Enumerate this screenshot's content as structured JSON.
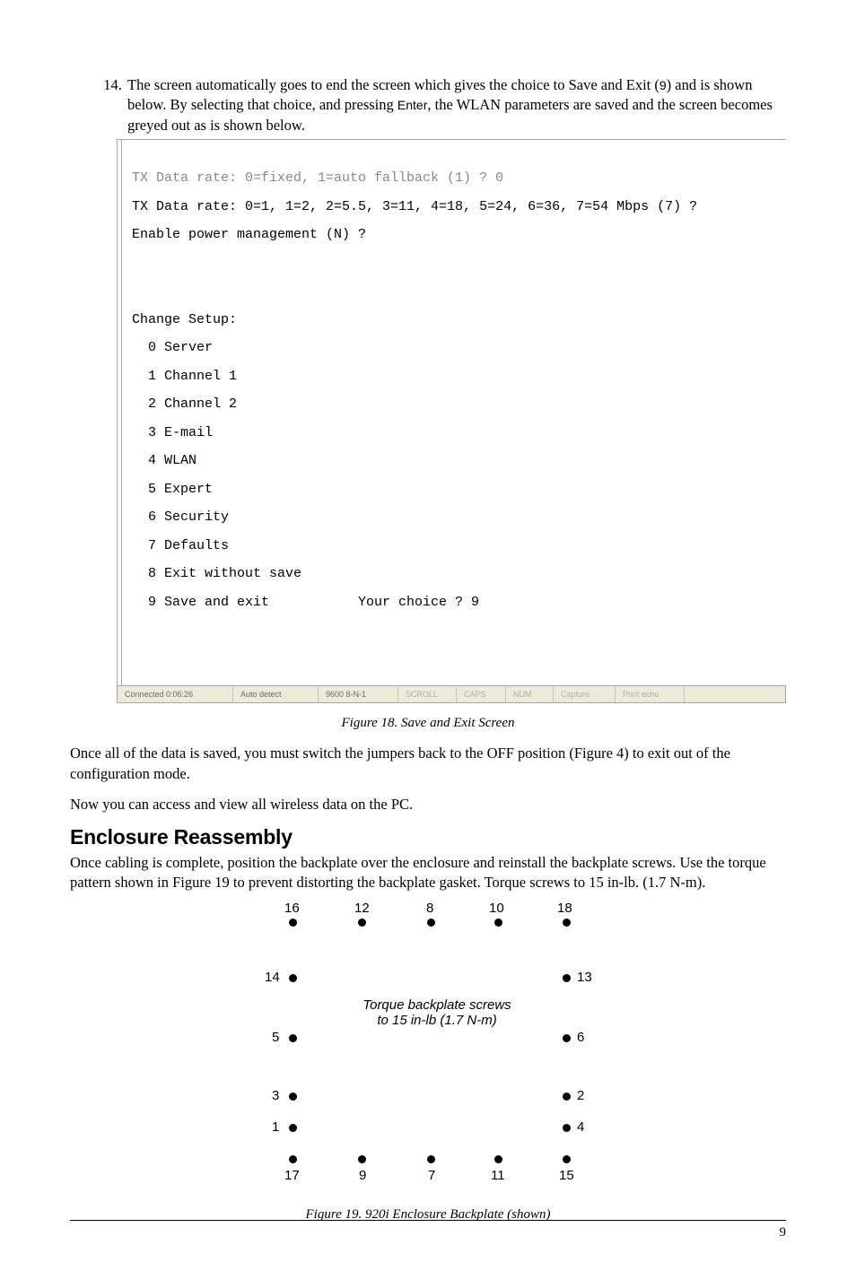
{
  "step": {
    "number": "14",
    "text_before_9": "The screen automatically goes to end the screen which gives the choice to Save and Exit (",
    "nine": "9",
    "text_after_9": ") and is shown below. By selecting that choice, and pressing ",
    "enter": "Enter",
    "text_after_enter": ", the WLAN parameters are saved and the screen becomes greyed out as is shown below."
  },
  "terminal": {
    "grey_line": "TX Data rate: 0=fixed, 1=auto fallback (1) ? 0",
    "line_tx": "TX Data rate: 0=1, 1=2, 2=5.5, 3=11, 4=18, 5=24, 6=36, 7=54 Mbps (7) ?",
    "line_pm": "Enable power management (N) ?",
    "change_setup": "Change Setup:",
    "opt0": "  0 Server",
    "opt1": "  1 Channel 1",
    "opt2": "  2 Channel 2",
    "opt3": "  3 E-mail",
    "opt4": "  4 WLAN",
    "opt5": "  5 Expert",
    "opt6": "  6 Security",
    "opt7": "  7 Defaults",
    "opt8": "  8 Exit without save",
    "opt9": "  9 Save and exit           Your choice ? 9"
  },
  "statusbar": {
    "connected": "Connected 0:06:26",
    "autodetect": "Auto detect",
    "baud": "9600 8-N-1",
    "scroll": "SCROLL",
    "caps": "CAPS",
    "num": "NUM",
    "capture": "Capture",
    "printecho": "Print echo"
  },
  "fig18": "Figure 18. Save and Exit Screen",
  "para1": "Once all of the data is saved, you must switch the jumpers back to the OFF position (Figure 4) to exit out of the configuration mode.",
  "para2": "Now you can access and view all wireless data on the PC.",
  "section": "Enclosure Reassembly",
  "para3": "Once cabling is complete, position the backplate over the enclosure and reinstall the backplate screws. Use the torque pattern shown in Figure 19 to prevent distorting the backplate gasket. Torque screws to 15 in-lb. (1.7 N-m).",
  "torque1": "Torque backplate screws",
  "torque2": "to 15 in-lb (1.7 N-m)",
  "fig19": "Figure 19. 920i Enclosure Backplate (shown)",
  "pagenum": "9",
  "labels": {
    "t1": "16",
    "t2": "12",
    "t3": "8",
    "t4": "10",
    "t5": "18",
    "l1": "14",
    "r1": "13",
    "l2": "5",
    "r2": "6",
    "l3": "3",
    "r3": "2",
    "l4": "1",
    "r4": "4",
    "b1": "17",
    "b2": "9",
    "b3": "7",
    "b4": "11",
    "b5": "15"
  }
}
